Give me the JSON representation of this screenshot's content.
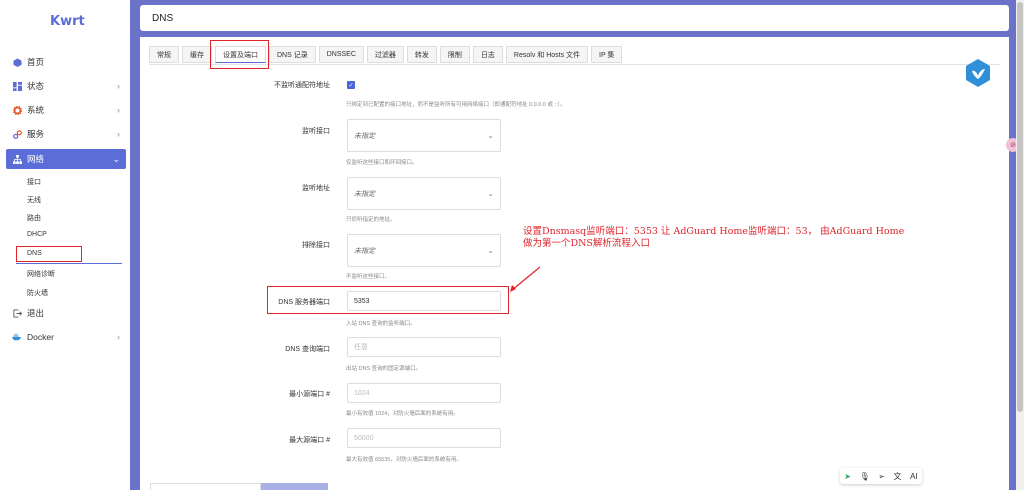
{
  "app": {
    "logo": "Kwrt",
    "page_title": "DNS"
  },
  "sidebar": {
    "items": [
      {
        "label": "首页",
        "icon": "cube-icon",
        "color": "#5b6dd6"
      },
      {
        "label": "状态",
        "icon": "dashboard-icon",
        "color": "#5b6dd6"
      },
      {
        "label": "系统",
        "icon": "gear-icon",
        "color": "#e8572a"
      },
      {
        "label": "服务",
        "icon": "link-icon",
        "color": "#5b6dd6"
      },
      {
        "label": "网络",
        "icon": "network-icon",
        "color": "#ffffff"
      },
      {
        "label": "退出",
        "icon": "logout-icon",
        "color": "#555555"
      },
      {
        "label": "Docker",
        "icon": "docker-icon",
        "color": "#2f8fd8"
      }
    ],
    "network_sub": [
      "接口",
      "无线",
      "路由",
      "DHCP",
      "DNS",
      "网络诊断",
      "防火墙"
    ]
  },
  "tabs": [
    "常规",
    "缓存",
    "设置及端口",
    "DNS 记录",
    "DNSSEC",
    "过滤器",
    "转发",
    "限制",
    "日志",
    "Resolv 和 Hosts 文件",
    "IP 集"
  ],
  "form": {
    "bind_wildcard": {
      "label": "不监听通配符地址",
      "hint": "只绑定到已配置的接口地址，而不是监听所有可用网络接口（即通配符地址 0.0.0.0 或 ::）。"
    },
    "listen_iface": {
      "label": "监听接口",
      "value": "未指定",
      "hint": "仅监听这些接口和环回接口。"
    },
    "listen_addr": {
      "label": "监听地址",
      "value": "未指定",
      "hint": "只侦听指定的地址。"
    },
    "exclude_iface": {
      "label": "排除接口",
      "value": "未指定",
      "hint": "不监听这些接口。"
    },
    "dns_port": {
      "label": "DNS 服务器端口",
      "value": "5353",
      "hint": "入站 DNS 查询的监听端口。"
    },
    "dns_query_port": {
      "label": "DNS 查询端口",
      "placeholder": "任意",
      "hint": "出站 DNS 查询的固定源端口。"
    },
    "min_src_port": {
      "label": "最小源端口 #",
      "placeholder": "1024",
      "hint": "最小有效值 1024，对防火墙后面的系统有用。"
    },
    "max_src_port": {
      "label": "最大源端口 #",
      "placeholder": "50000",
      "hint": "最大有效值 65535，对防火墙后面的系统有用。"
    }
  },
  "annotation": "设置Dnsmasq监听端口：5353 让 AdGuard Home监听端口：53， 由AdGuard Home\n做为第一个DNS解析流程入口",
  "colors": {
    "accent": "#5b6dd6",
    "annotation_red": "#e0242b",
    "checkbox": "#4a66d8"
  },
  "toolbar_icons": [
    "pin-icon",
    "mic-icon",
    "send-icon",
    "translate-icon",
    "ai-icon"
  ],
  "toolbar_ai": "AI"
}
